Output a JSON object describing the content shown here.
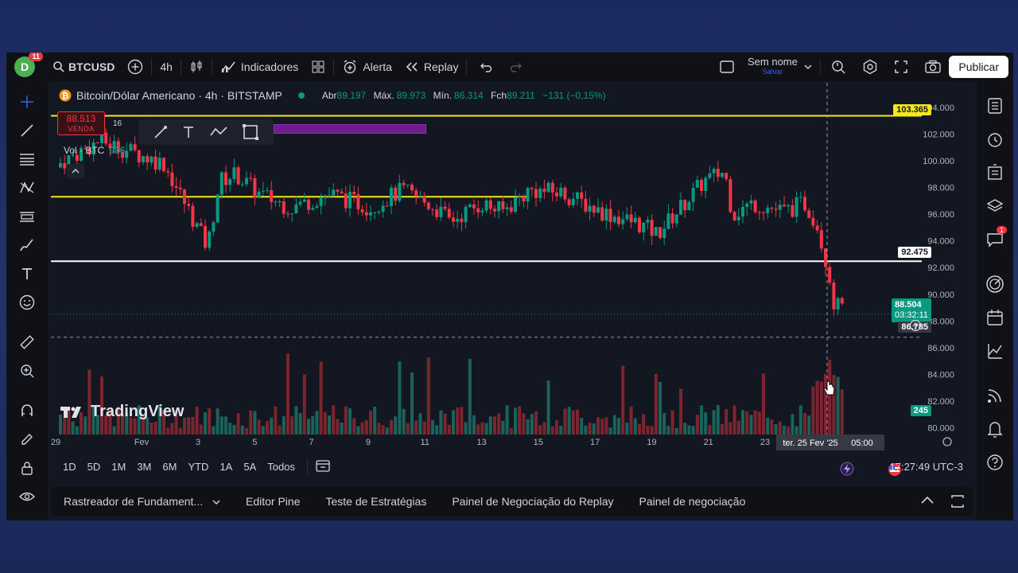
{
  "header": {
    "avatar_letter": "D",
    "notification_count": "11",
    "symbol": "BTCUSD",
    "interval": "4h",
    "indicators_label": "Indicadores",
    "alert_label": "Alerta",
    "replay_label": "Replay",
    "layout_name": "Sem nome",
    "layout_status": "Salvar",
    "publish_label": "Publicar"
  },
  "legend": {
    "title": "Bitcoin/Dólar Americano · 4h · BITSTAMP",
    "open_key": "Abr",
    "open_val": "89.197",
    "high_key": "Máx.",
    "high_val": "89.973",
    "low_key": "Mín.",
    "low_val": "86.314",
    "close_key": "Fch",
    "close_val": "89.211",
    "change_val": "−131 (−0,15%)"
  },
  "trade": {
    "sell_price": "88.513",
    "sell_label": "VENDA",
    "spread": "16"
  },
  "volume": {
    "label": "Vol · BTC",
    "value": "986",
    "tag": "245"
  },
  "brand": "TradingView",
  "price_tags": {
    "yellow_line": "103.365",
    "white_line": "92.475",
    "current": "88.504",
    "countdown": "03:32:11",
    "crosshair": "86.785"
  },
  "colors": {
    "up": "#089981",
    "down": "#f23645",
    "yellow_line": "#f5e61f",
    "background": "#131722"
  },
  "chart_data": {
    "type": "candlestick",
    "y_axis_ticks": [
      "104.000",
      "102.000",
      "100.000",
      "98.000",
      "96.000",
      "94.000",
      "92.000",
      "90.000",
      "88.000",
      "86.000",
      "84.000",
      "82.000",
      "80.000"
    ],
    "x_axis_ticks": [
      "29",
      "Fev",
      "3",
      "5",
      "7",
      "9",
      "11",
      "13",
      "15",
      "17",
      "19",
      "21",
      "23"
    ],
    "crosshair_date": "ter. 25 Fev '25",
    "crosshair_time": "05:00",
    "horizontal_lines": [
      103.365,
      97.3,
      92.475
    ],
    "ylim": [
      79.5,
      105
    ]
  },
  "timeframes": [
    "1D",
    "5D",
    "1M",
    "3M",
    "6M",
    "YTD",
    "1A",
    "5A",
    "Todos"
  ],
  "clock": "17:27:49 UTC-3",
  "bottom_panel": {
    "tabs": [
      "Rastreador de Fundament...",
      "Editor Pine",
      "Teste de Estratégias",
      "Painel de Negociação do Replay",
      "Painel de negociação"
    ]
  }
}
